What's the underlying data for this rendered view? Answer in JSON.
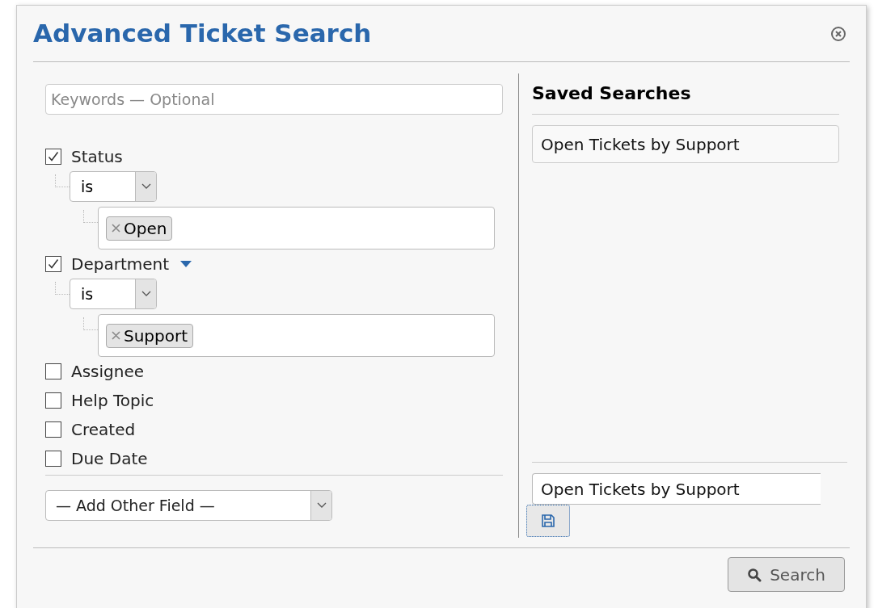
{
  "dialog": {
    "title": "Advanced Ticket Search"
  },
  "keywords": {
    "placeholder": "Keywords — Optional"
  },
  "criteria": [
    {
      "label": "Status",
      "checked": true,
      "menu_arrow": false,
      "operator": "is",
      "values": [
        "Open"
      ]
    },
    {
      "label": "Department",
      "checked": true,
      "menu_arrow": true,
      "operator": "is",
      "values": [
        "Support"
      ]
    },
    {
      "label": "Assignee",
      "checked": false,
      "menu_arrow": false
    },
    {
      "label": "Help Topic",
      "checked": false,
      "menu_arrow": false
    },
    {
      "label": "Created",
      "checked": false,
      "menu_arrow": false
    },
    {
      "label": "Due Date",
      "checked": false,
      "menu_arrow": false
    }
  ],
  "add_field": {
    "value": "— Add Other Field —"
  },
  "saved_searches": {
    "heading": "Saved Searches",
    "items": [
      "Open Tickets by Support"
    ],
    "name_input": {
      "value": "Open Tickets by Support"
    }
  },
  "search_button": {
    "label": "Search"
  }
}
